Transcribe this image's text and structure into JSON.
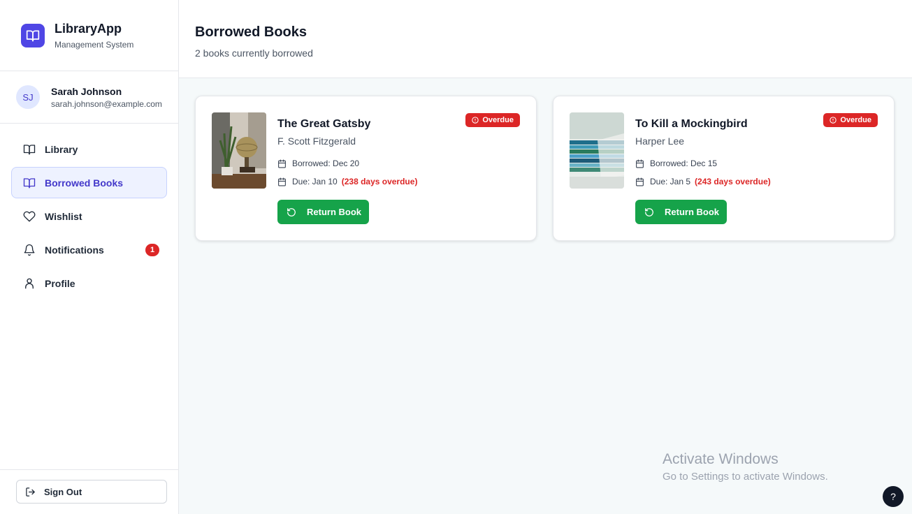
{
  "brand": {
    "title": "LibraryApp",
    "subtitle": "Management System",
    "logo_icon": "book-open-icon",
    "color": "#4f46e5"
  },
  "user": {
    "initials": "SJ",
    "name": "Sarah Johnson",
    "email": "sarah.johnson@example.com"
  },
  "nav": {
    "items": [
      {
        "label": "Library",
        "icon": "book-open-icon",
        "active": false
      },
      {
        "label": "Borrowed Books",
        "icon": "book-open-icon",
        "active": true
      },
      {
        "label": "Wishlist",
        "icon": "heart-icon",
        "active": false
      },
      {
        "label": "Notifications",
        "icon": "bell-icon",
        "active": false,
        "badge": "1"
      },
      {
        "label": "Profile",
        "icon": "user-icon",
        "active": false
      }
    ]
  },
  "signout": {
    "label": "Sign Out",
    "icon": "sign-out-icon"
  },
  "header": {
    "title": "Borrowed Books",
    "subtitle": "2 books currently borrowed"
  },
  "books": [
    {
      "title": "The Great Gatsby",
      "author": "F. Scott Fitzgerald",
      "borrowed": "Borrowed: Dec 20",
      "due": "Due: Jan 10",
      "overdue_text": "(238 days overdue)",
      "badge": "Overdue",
      "button": "Return Book"
    },
    {
      "title": "To Kill a Mockingbird",
      "author": "Harper Lee",
      "borrowed": "Borrowed: Dec 15",
      "due": "Due: Jan 5",
      "overdue_text": "(243 days overdue)",
      "badge": "Overdue",
      "button": "Return Book"
    }
  ],
  "watermark": {
    "title": "Activate Windows",
    "subtitle": "Go to Settings to activate Windows."
  },
  "help": {
    "label": "?"
  },
  "colors": {
    "accent": "#4f46e5",
    "danger": "#dc2626",
    "success": "#16a34a"
  }
}
